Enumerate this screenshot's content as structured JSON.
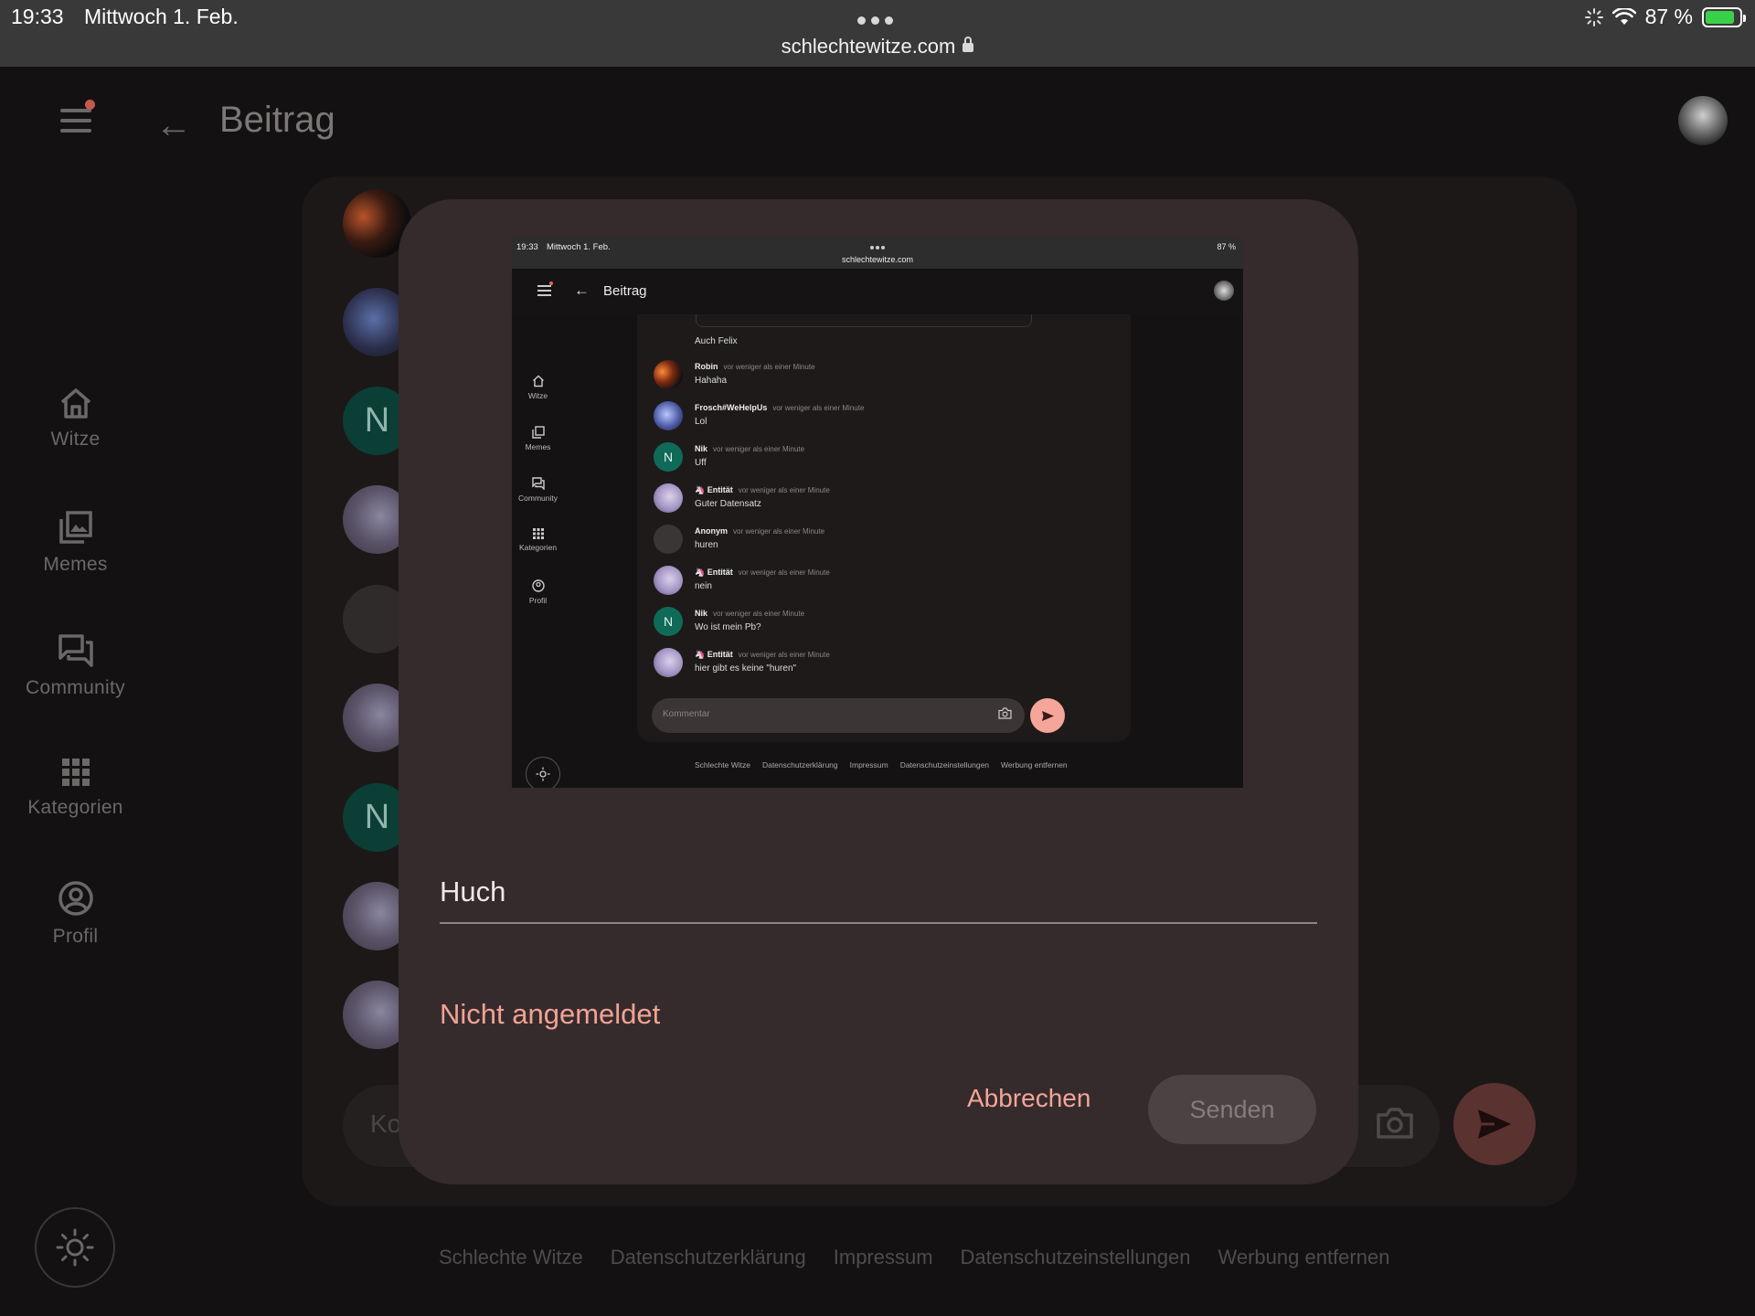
{
  "status_bar": {
    "time": "19:33",
    "date": "Mittwoch 1. Feb.",
    "url": "schlechtewitze.com",
    "battery": "87 %"
  },
  "app": {
    "page_title": "Beitrag",
    "nav": [
      {
        "label": "Witze",
        "icon": "home-icon"
      },
      {
        "label": "Memes",
        "icon": "gallery-icon"
      },
      {
        "label": "Community",
        "icon": "forum-icon"
      },
      {
        "label": "Kategorien",
        "icon": "grid-icon"
      },
      {
        "label": "Profil",
        "icon": "account-circle-icon"
      }
    ],
    "comment_placeholder": "Ko",
    "footer": [
      "Schlechte Witze",
      "Datenschutzerklärung",
      "Impressum",
      "Datenschutzeinstellungen",
      "Werbung entfernen"
    ]
  },
  "dialog": {
    "field_value": "Huch",
    "status": "Nicht angemeldet",
    "cancel_label": "Abbrechen",
    "send_label": "Senden"
  },
  "embedded": {
    "time": "19:33",
    "date": "Mittwoch 1. Feb.",
    "url": "schlechtewitze.com",
    "battery": "87 %",
    "title": "Beitrag",
    "nav": [
      "Witze",
      "Memes",
      "Community",
      "Kategorien",
      "Profil"
    ],
    "first_message": "Auch Felix",
    "comments": [
      {
        "name": "Robin",
        "time": "vor weniger als einer Minute",
        "text": "Hahaha",
        "avatar": "robin"
      },
      {
        "name": "Frosch#WeHelpUs",
        "time": "vor weniger als einer Minute",
        "text": "Lol",
        "avatar": "frosch"
      },
      {
        "name": "Nik",
        "time": "vor weniger als einer Minute",
        "text": "Uff",
        "avatar": "n"
      },
      {
        "name": "🦄 Entität",
        "time": "vor weniger als einer Minute",
        "text": "Guter Datensatz",
        "avatar": "anime"
      },
      {
        "name": "Anonym",
        "time": "vor weniger als einer Minute",
        "text": "huren",
        "avatar": "anon"
      },
      {
        "name": "🦄 Entität",
        "time": "vor weniger als einer Minute",
        "text": "nein",
        "avatar": "anime"
      },
      {
        "name": "Nik",
        "time": "vor weniger als einer Minute",
        "text": "Wo ist mein Pb?",
        "avatar": "n"
      },
      {
        "name": "🦄 Entität",
        "time": "vor weniger als einer Minute",
        "text": "hier gibt es keine \"huren\"",
        "avatar": "anime"
      }
    ],
    "avatar_letter": "N",
    "comment_placeholder": "Kommentar",
    "footer": [
      "Schlechte Witze",
      "Datenschutzerklärung",
      "Impressum",
      "Datenschutzeinstellungen",
      "Werbung entfernen"
    ]
  },
  "colors": {
    "accent": "#f3a598",
    "dialog_bg": "#352b2c",
    "send_button": "#5a3230"
  }
}
